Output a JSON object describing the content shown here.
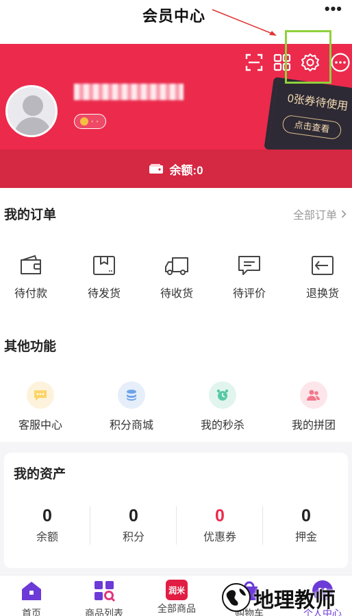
{
  "annotation": {
    "caption": "会员中心",
    "highlight_color": "#8fd13c",
    "arrow_color": "#e03535"
  },
  "topbar": {
    "more": "•••"
  },
  "header": {
    "bg_color": "#ec2a4c",
    "icons": [
      "scan-icon",
      "qrcode-icon",
      "settings-icon",
      "more-icon"
    ]
  },
  "coupon": {
    "title": "0张券待使用",
    "button": "点击查看"
  },
  "balance": {
    "label": "余额:0"
  },
  "orders": {
    "title": "我的订单",
    "all": "全部订单",
    "items": [
      {
        "label": "待付款",
        "icon": "wallet-icon"
      },
      {
        "label": "待发货",
        "icon": "box-icon"
      },
      {
        "label": "待收货",
        "icon": "truck-icon"
      },
      {
        "label": "待评价",
        "icon": "comment-icon"
      },
      {
        "label": "退换货",
        "icon": "return-icon"
      }
    ]
  },
  "other": {
    "title": "其他功能",
    "items": [
      {
        "label": "客服中心",
        "icon": "chat-icon",
        "color": "#fcd56a"
      },
      {
        "label": "积分商城",
        "icon": "coins-icon",
        "color": "#6fa3e8"
      },
      {
        "label": "我的秒杀",
        "icon": "alarm-icon",
        "color": "#59c9a5"
      },
      {
        "label": "我的拼团",
        "icon": "group-icon",
        "color": "#f0788a"
      }
    ]
  },
  "assets": {
    "title": "我的资产",
    "items": [
      {
        "value": "0",
        "label": "余额"
      },
      {
        "value": "0",
        "label": "积分"
      },
      {
        "value": "0",
        "label": "优惠券",
        "highlight": true
      },
      {
        "value": "0",
        "label": "押金"
      }
    ]
  },
  "tabbar": {
    "active_color": "#6c3ad6",
    "items": [
      {
        "label": "首页",
        "icon": "home-icon"
      },
      {
        "label": "商品列表",
        "icon": "grid-search-icon"
      },
      {
        "label": "全部商品",
        "icon": "brand-icon",
        "icon_text": "润米"
      },
      {
        "label": "购物车",
        "icon": "cart-icon"
      },
      {
        "label": "个人中心",
        "icon": "user-icon"
      }
    ]
  },
  "watermark": {
    "text": "地理教师"
  }
}
